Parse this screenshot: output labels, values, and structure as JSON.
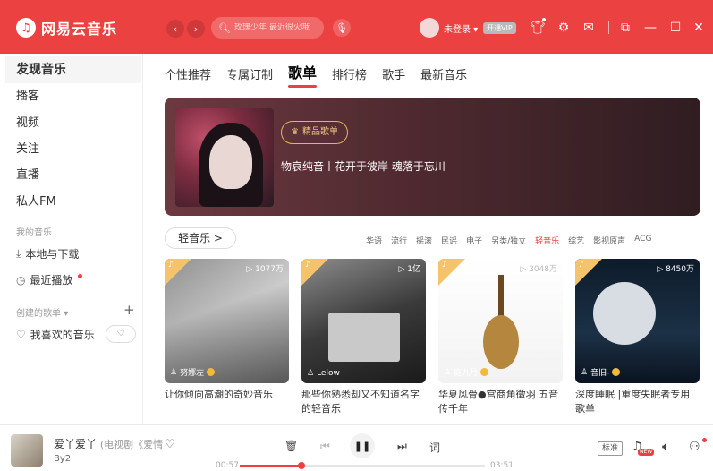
{
  "app": {
    "logo_mark": "♫",
    "name": "网易云音乐"
  },
  "topbar": {
    "search_placeholder": "玫瑰少年 最近很火哦",
    "login": "未登录 ▾",
    "vip": "开通VIP"
  },
  "sidebar": {
    "items": [
      "发现音乐",
      "播客",
      "视频",
      "关注",
      "直播",
      "私人FM"
    ],
    "my_music_head": "我的音乐",
    "local": "本地与下载",
    "recent": "最近播放",
    "created_head": "创建的歌单",
    "created_caret": "▾",
    "liked": "我喜欢的音乐"
  },
  "tabs": [
    "个性推荐",
    "专属订制",
    "歌单",
    "排行榜",
    "歌手",
    "最新音乐"
  ],
  "banner": {
    "tag": "精品歌单",
    "title": "物哀纯音丨花开于彼岸 魂落于忘川"
  },
  "category_button": "轻音乐 >",
  "genres": [
    "华语",
    "流行",
    "摇滚",
    "民谣",
    "电子",
    "另类/独立",
    "轻音乐",
    "综艺",
    "影视原声",
    "ACG"
  ],
  "genre_active": "轻音乐",
  "playlists": [
    {
      "plays": "▷ 1077万",
      "creator": "努娜左",
      "title": "让你倾向高潮的奇妙音乐"
    },
    {
      "plays": "▷ 1亿",
      "creator": "Lelow",
      "title": "那些你熟悉却又不知道名字的轻音乐"
    },
    {
      "plays": "▷ 3048万",
      "creator": "庭九月",
      "title": "华夏风骨●宫商角徵羽 五音传千年"
    },
    {
      "plays": "▷ 8450万",
      "creator": "音旧-",
      "title": "深度睡眠 |重度失眠者专用歌单"
    }
  ],
  "player": {
    "song": "爱丫爱丫",
    "song_sub": "(电视剧《爱情",
    "artist": "By2",
    "elapsed": "00:57",
    "total": "03:51",
    "progress": 0.25,
    "lyric": "词",
    "quality": "标准"
  },
  "colors": {
    "brand": "#ec4141",
    "vip_badge": "#f4b83a"
  }
}
